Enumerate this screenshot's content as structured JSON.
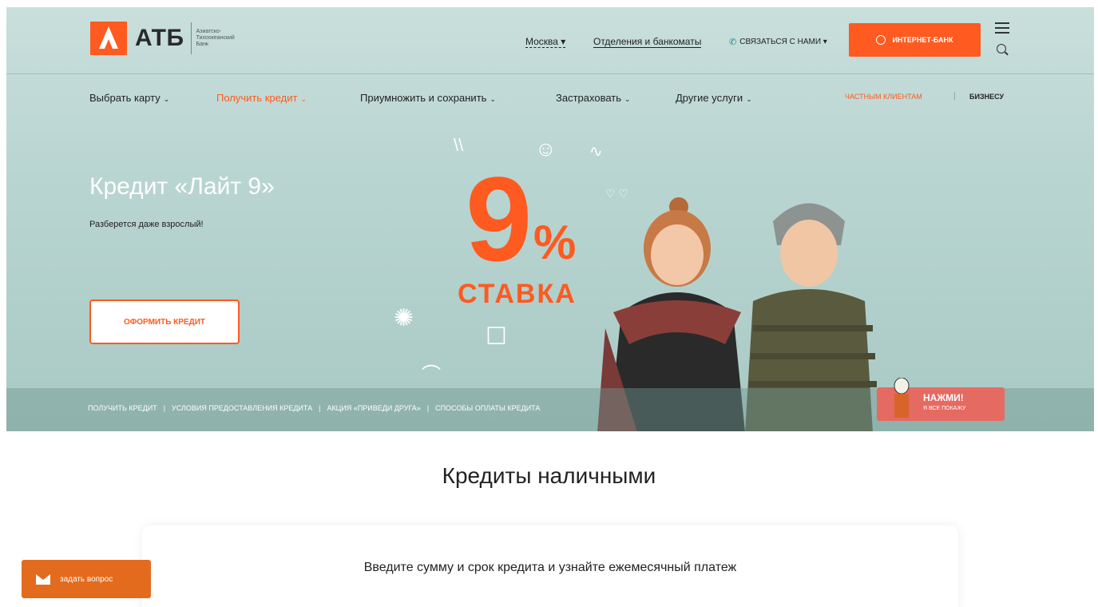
{
  "header": {
    "logo_name": "АТБ",
    "logo_description": "Азиатско-\nТихоокеанский\nБанк",
    "city": "Москва ▾",
    "branches": "Отделения и банкоматы",
    "contact": "СВЯЗАТЬСЯ С НАМИ ▾",
    "internet_bank": "ИНТЕРНЕТ-БАНК"
  },
  "nav": {
    "items": [
      {
        "label": "Выбрать карту"
      },
      {
        "label": "Получить кредит"
      },
      {
        "label": "Приумножить и сохранить"
      },
      {
        "label": "Застраховать"
      },
      {
        "label": "Другие услуги"
      }
    ],
    "segment_private": "ЧАСТНЫМ КЛИЕНТАМ",
    "segment_business": "БИЗНЕСУ"
  },
  "hero": {
    "title": "Кредит «Лайт 9»",
    "subtitle": "Разберется даже взрослый!",
    "cta": "ОФОРМИТЬ КРЕДИТ",
    "promo_number": "9",
    "promo_percent": "%",
    "promo_word": "СТАВКА"
  },
  "subnav": {
    "items": [
      "ПОЛУЧИТЬ КРЕДИТ",
      "УСЛОВИЯ ПРЕДОСТАВЛЕНИЯ КРЕДИТА",
      "АКЦИЯ «ПРИВЕДИ ДРУГА»",
      "СПОСОБЫ ОПЛАТЫ КРЕДИТА"
    ]
  },
  "badge": {
    "main": "НАЖМИ!",
    "sub": "Я ВСЕ ПОКАЖУ"
  },
  "section": {
    "title": "Кредиты наличными",
    "calc_text": "Введите сумму и срок кредита и узнайте ежемесячный платеж"
  },
  "ask_button": "задать вопрос",
  "colors": {
    "accent": "#ff5a1f",
    "hero_bg": "#b9d5d1",
    "ask_bg": "#e36b1e",
    "badge_bg": "#e56a62"
  }
}
